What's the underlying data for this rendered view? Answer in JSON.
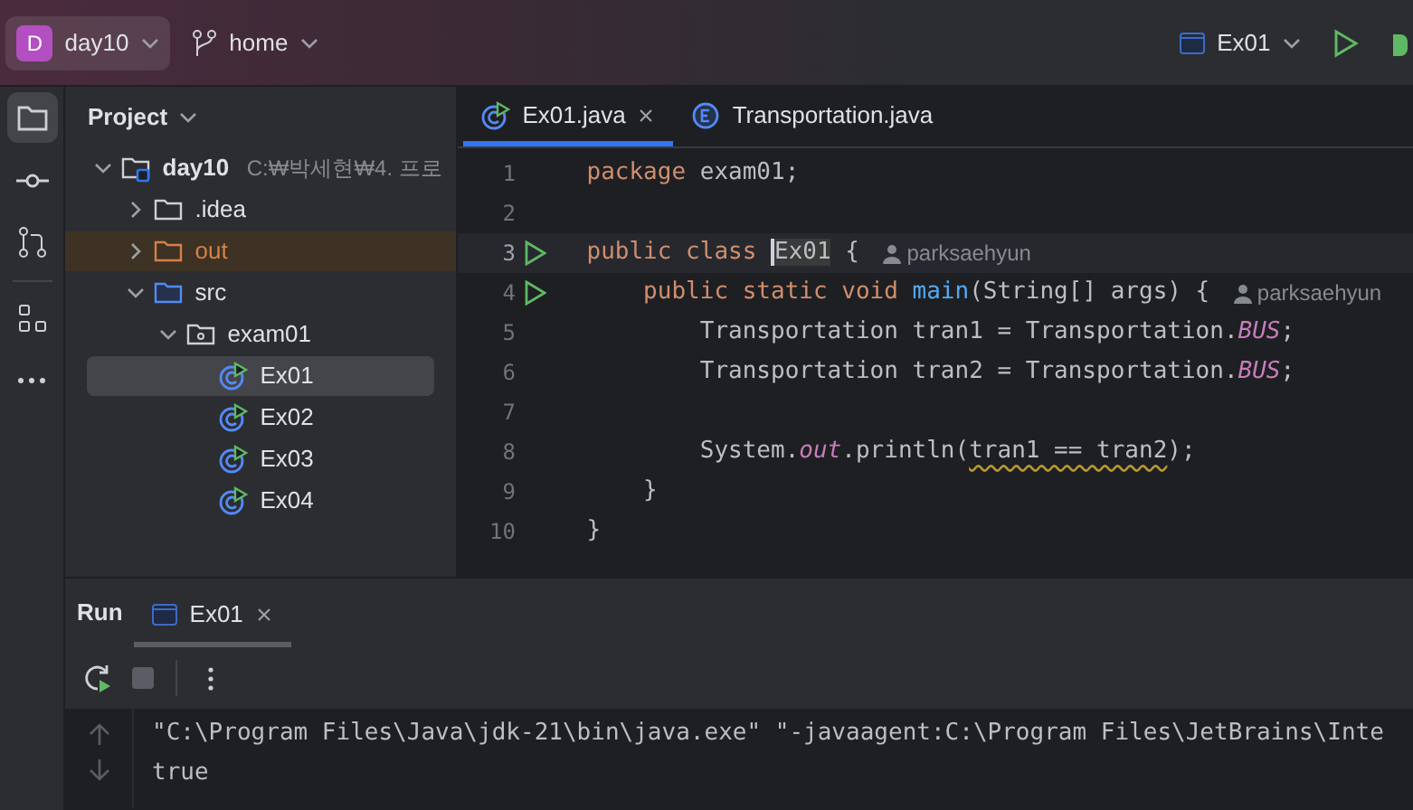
{
  "toolbar": {
    "project": {
      "letter": "D",
      "name": "day10"
    },
    "branch": "home",
    "run_config": "Ex01"
  },
  "project_panel": {
    "title": "Project",
    "tree": [
      {
        "label": "day10",
        "path": "C:₩박세현₩4. 프로",
        "kind": "module",
        "expanded": true,
        "selected": false,
        "children": [
          {
            "label": ".idea",
            "kind": "folder",
            "expanded": false,
            "selected": false
          },
          {
            "label": "out",
            "kind": "excluded",
            "expanded": false,
            "selected": false
          },
          {
            "label": "src",
            "kind": "source",
            "expanded": true,
            "selected": false,
            "children": [
              {
                "label": "exam01",
                "kind": "package",
                "expanded": true,
                "selected": false,
                "children": [
                  {
                    "label": "Ex01",
                    "kind": "class",
                    "selected": true
                  },
                  {
                    "label": "Ex02",
                    "kind": "class",
                    "selected": false
                  },
                  {
                    "label": "Ex03",
                    "kind": "class",
                    "selected": false
                  },
                  {
                    "label": "Ex04",
                    "kind": "class",
                    "selected": false
                  }
                ]
              }
            ]
          }
        ]
      }
    ]
  },
  "editor": {
    "tabs": [
      {
        "label": "Ex01.java",
        "kind": "class",
        "selected": true
      },
      {
        "label": "Transportation.java",
        "kind": "enum",
        "selected": false
      }
    ],
    "lines": [
      {
        "number": "1",
        "current": false,
        "tokens": [
          {
            "t": "package",
            "kind": "kw"
          },
          {
            "t": " exam01;",
            "kind": "plain"
          }
        ]
      },
      {
        "number": "2",
        "current": false
      },
      {
        "number": "3",
        "run": true,
        "current": true,
        "author": "parksaehyun",
        "tokens": [
          {
            "t": "public class ",
            "kind": "kw"
          },
          {
            "t": "Ex01",
            "kind": "caret"
          },
          {
            "t": " {",
            "kind": "plain"
          }
        ]
      },
      {
        "number": "4",
        "run": true,
        "current": false,
        "author": "parksaehyun",
        "tokens": [
          {
            "t": "    public static void ",
            "kind": "kw"
          },
          {
            "t": "main",
            "kind": "fn"
          },
          {
            "t": "(String[] args) {",
            "kind": "plain"
          }
        ]
      },
      {
        "number": "5",
        "current": false,
        "tokens": [
          {
            "t": "        Transportation tran1 = Transportation.",
            "kind": "plain"
          },
          {
            "t": "BUS",
            "kind": "static"
          },
          {
            "t": ";",
            "kind": "plain"
          }
        ]
      },
      {
        "number": "6",
        "current": false,
        "tokens": [
          {
            "t": "        Transportation tran2 = Transportation.",
            "kind": "plain"
          },
          {
            "t": "BUS",
            "kind": "static"
          },
          {
            "t": ";",
            "kind": "plain"
          }
        ]
      },
      {
        "number": "7",
        "current": false
      },
      {
        "number": "8",
        "current": false,
        "tokens": [
          {
            "t": "        System.",
            "kind": "plain"
          },
          {
            "t": "out",
            "kind": "static"
          },
          {
            "t": ".println(",
            "kind": "plain"
          },
          {
            "t": "tran1 == tran2",
            "kind": "warn"
          },
          {
            "t": ");",
            "kind": "plain"
          }
        ]
      },
      {
        "number": "9",
        "current": false,
        "tokens": [
          {
            "t": "    }",
            "kind": "plain"
          }
        ]
      },
      {
        "number": "10",
        "current": false,
        "tokens": [
          {
            "t": "}",
            "kind": "plain"
          }
        ]
      }
    ]
  },
  "run_panel": {
    "title": "Run",
    "tabs": [
      {
        "label": "Ex01",
        "selected": true
      }
    ],
    "console": [
      "\"C:\\Program Files\\Java\\jdk-21\\bin\\java.exe\" \"-javaagent:C:\\Program Files\\JetBrains\\Inte",
      "true"
    ]
  }
}
